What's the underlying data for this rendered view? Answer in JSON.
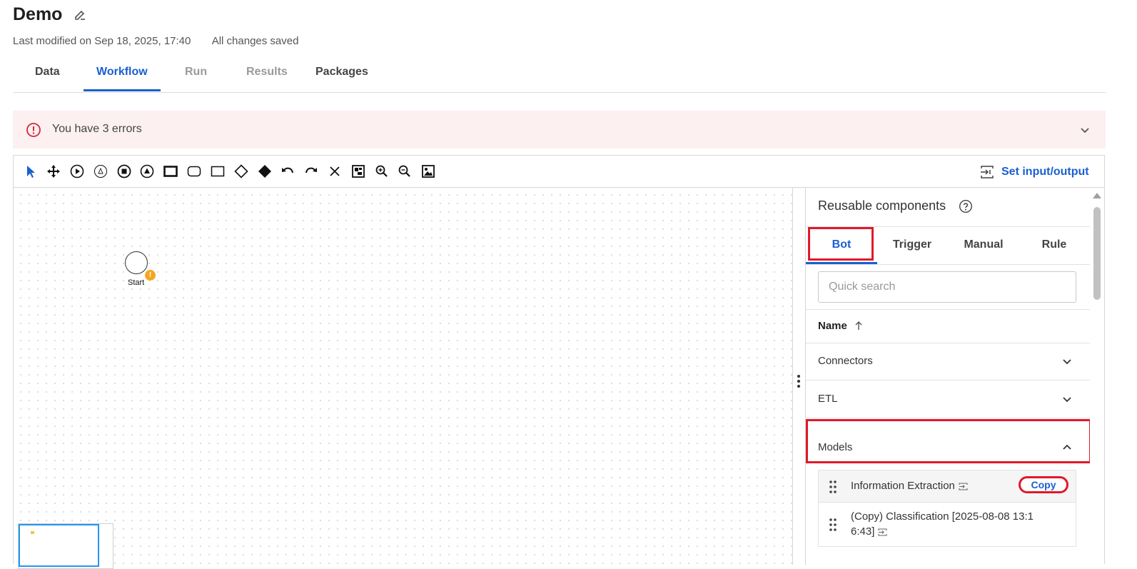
{
  "project": {
    "title": "Demo",
    "last_modified": "Last modified on Sep 18, 2025, 17:40",
    "save_status": "All changes saved"
  },
  "tabs": [
    {
      "label": "Data",
      "state": "enabled"
    },
    {
      "label": "Workflow",
      "state": "active"
    },
    {
      "label": "Run",
      "state": "disabled"
    },
    {
      "label": "Results",
      "state": "disabled"
    },
    {
      "label": "Packages",
      "state": "enabled"
    }
  ],
  "error_banner": {
    "text": "You have 3 errors"
  },
  "toolbar": {
    "tools": [
      "select-pointer-icon",
      "move-icon",
      "start-event-icon",
      "intermediate-event-icon",
      "end-event-icon",
      "escalation-event-icon",
      "task-icon",
      "subprocess-icon",
      "rectangle-icon",
      "gateway-icon",
      "filled-gateway-icon",
      "undo-icon",
      "redo-icon",
      "delete-icon",
      "fit-view-icon",
      "zoom-in-icon",
      "zoom-out-icon",
      "image-export-icon"
    ],
    "set_io_label": "Set input/output"
  },
  "canvas": {
    "start_label": "Start",
    "start_warning": "!"
  },
  "panel": {
    "title": "Reusable components",
    "tabs": [
      "Bot",
      "Trigger",
      "Manual",
      "Rule"
    ],
    "active_tab": "Bot",
    "search_placeholder": "Quick search",
    "column_name": "Name",
    "sections": {
      "connectors": "Connectors",
      "etl": "ETL",
      "models": "Models"
    },
    "model_items": [
      {
        "label": "Information Extraction",
        "action": "Copy"
      },
      {
        "label_line1": "(Copy) Classification [2025-08-08 13:1",
        "label_line2": "6:43]"
      }
    ]
  },
  "colors": {
    "accent": "#1a5fd0",
    "error": "#e0192a",
    "banner_bg": "#fcf0f1",
    "warning": "#f5a623"
  }
}
